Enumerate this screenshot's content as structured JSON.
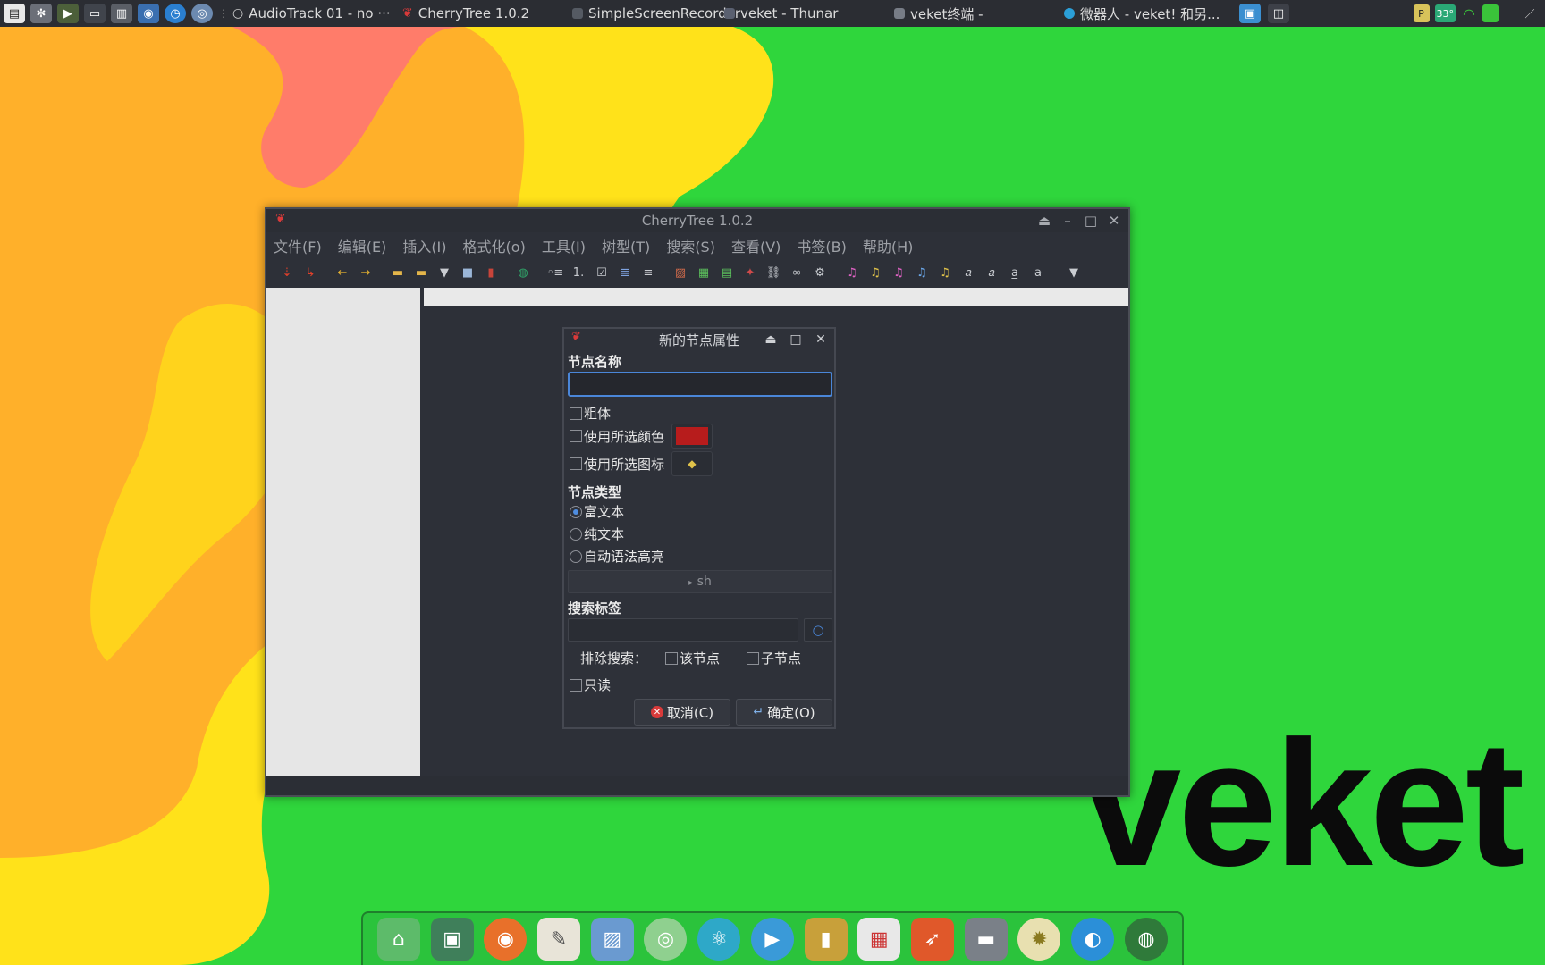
{
  "desktop": {
    "brand_text": "veket"
  },
  "topbar": {
    "tasks": [
      {
        "label": "AudioTrack 01 - no ···",
        "icon": "circle-icon",
        "color": "#cfcfcf"
      },
      {
        "label": "CherryTree 1.0.2",
        "icon": "cherry-icon",
        "color": "#d93a3a"
      },
      {
        "label": "SimpleScreenRecorder",
        "icon": "recorder-icon",
        "color": "#555a63"
      },
      {
        "label": "veket - Thunar",
        "icon": "folder-icon",
        "color": "#5a6070"
      },
      {
        "label": "veket终端 -",
        "icon": "terminal-icon",
        "color": "#777c86"
      },
      {
        "label": "微器人 - veket! 和另...",
        "icon": "edge-icon",
        "color": "#2b9fd8"
      }
    ],
    "tray": {
      "temperature": "33°"
    }
  },
  "window": {
    "title": "CherryTree 1.0.2",
    "menu": [
      "文件(F)",
      "编辑(E)",
      "插入(I)",
      "格式化(o)",
      "工具(I)",
      "树型(T)",
      "搜索(S)",
      "查看(V)",
      "书签(B)",
      "帮助(H)"
    ]
  },
  "dialog": {
    "title": "新的节点属性",
    "node_name_label": "节点名称",
    "node_name_value": "",
    "bold_label": "粗体",
    "use_color_label": "使用所选颜色",
    "use_icon_label": "使用所选图标",
    "node_color": "#b71c1c",
    "node_type_label": "节点类型",
    "type_rich": "富文本",
    "type_plain": "纯文本",
    "type_auto": "自动语法高亮",
    "syntax_value": "sh",
    "tags_label": "搜索标签",
    "tags_value": "",
    "exclude_label": "排除搜索：",
    "exclude_this": "该节点",
    "exclude_children": "子节点",
    "readonly_label": "只读",
    "cancel_label": "取消(C)",
    "ok_label": "确定(O)"
  },
  "colors": {
    "accent": "#4a86d8",
    "dock": "#28b43c"
  }
}
